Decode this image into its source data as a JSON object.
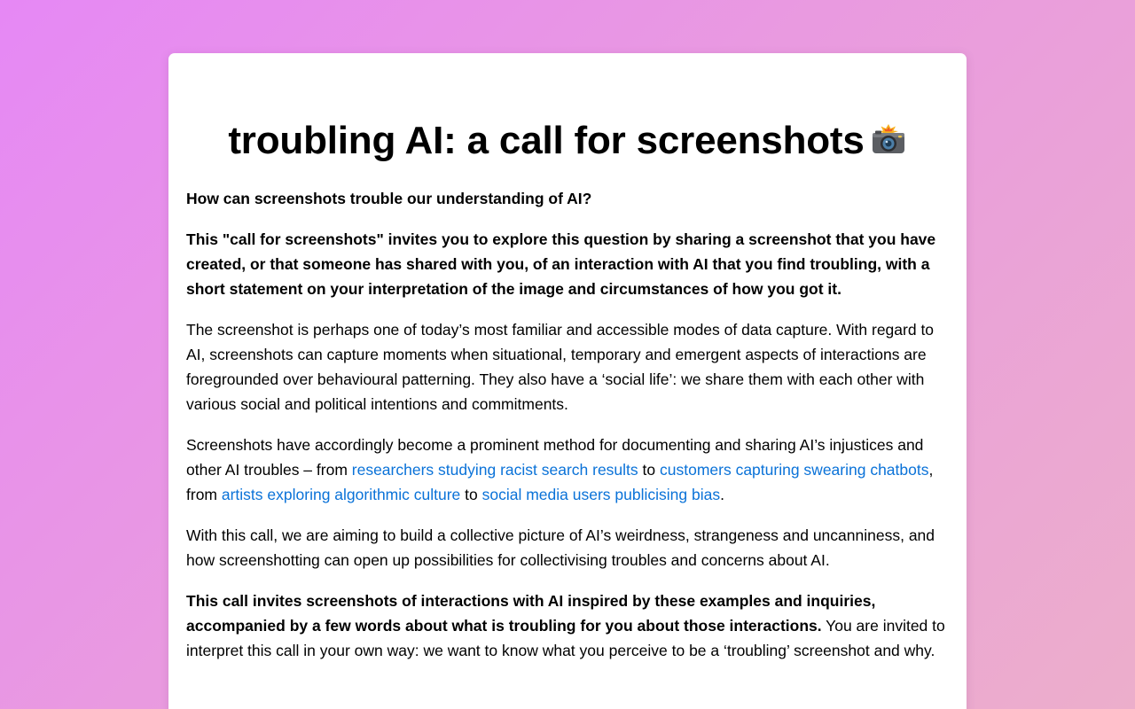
{
  "page": {
    "title": "troubling AI: a call for screenshots",
    "title_icon": "camera-flash-icon"
  },
  "intro": {
    "question": "How can screenshots trouble our understanding of AI?",
    "invite": "This \"call for screenshots\" invites you to explore this question by sharing a screenshot that you have created, or that someone has shared with you, of an interaction with AI that you find troubling, with a short statement on your interpretation of the image and circumstances of how you got it."
  },
  "body": {
    "p1": "The screenshot is perhaps one of today’s most familiar and accessible modes of data capture. With regard to AI, screenshots can capture moments when situational, temporary and emergent aspects of interactions are foregrounded over behavioural patterning. They also have a ‘social life’: we share them with each other with various social and political intentions and commitments.",
    "p2": {
      "lead": "Screenshots have accordingly become a prominent method for documenting and sharing AI’s injustices and other AI troubles – from ",
      "link1": "researchers studying racist search results",
      "to1": " to ",
      "link2": "customers capturing swearing chatbots",
      "mid": ", from ",
      "link3": "artists exploring algorithmic culture",
      "to2": " to ",
      "link4": "social media users publicising bias",
      "end": "."
    },
    "p3": "With this call, we are aiming to build a collective picture of AI’s weirdness, strangeness and uncanniness, and how screenshotting can open up possibilities for collectivising troubles and concerns about AI.",
    "p4": {
      "bold": "This call invites screenshots of interactions with AI inspired by these examples and inquiries, accompanied by a few words about what is troubling for you about those interactions.",
      "rest": " You are invited to interpret this call in your own way: we want to know what you perceive to be a ‘troubling’ screenshot and why."
    }
  },
  "colors": {
    "link": "#0a72d8",
    "background_start": "#e688f5",
    "background_end": "#ecaecb"
  }
}
